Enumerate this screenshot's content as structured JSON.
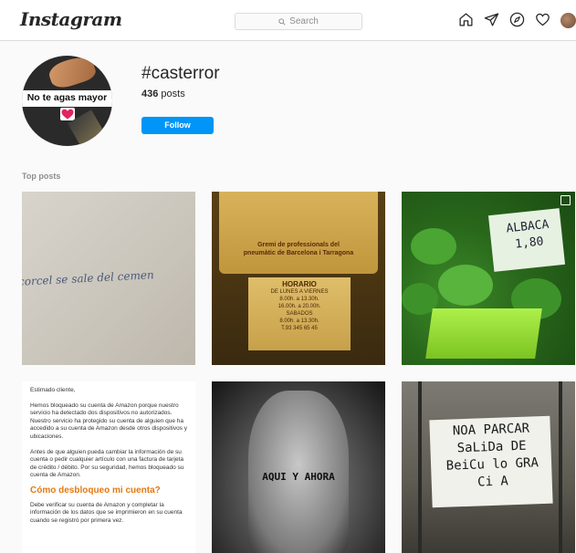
{
  "app": {
    "logo": "Instagram"
  },
  "header": {
    "search_placeholder": "Search"
  },
  "nav": {
    "icons": [
      "home-icon",
      "direct-icon",
      "explore-icon",
      "heart-icon",
      "profile-avatar"
    ]
  },
  "hashtag": {
    "title": "#casterror",
    "post_count": "436",
    "post_suffix": " posts",
    "follow_label": "Follow",
    "profile_pic_text": "No te agas mayor"
  },
  "section": {
    "top_posts": "Top posts"
  },
  "posts": [
    {
      "handwriting": "corcel se sale del cemen"
    },
    {
      "plate_line1": "Gremi de professionals del",
      "plate_line2": "pneumàtic de Barcelona i Tarragona",
      "board_title": "HORARIO",
      "board_lines": [
        "DE LUNES A VIERNES",
        "8.00h. a 13.30h.",
        "16.00h. a 20.00h.",
        "SABADOS",
        "8.00h. a 13.30h.",
        "T.93 345 65 45"
      ]
    },
    {
      "label_line1": "ALBACA",
      "label_line2": "1,80"
    },
    {
      "greeting": "Estimado cliente,",
      "para1": "Hemos bloqueado su cuenta de Amazon porque nuestro servicio ha detectado dos dispositivos no autorizados. Nuestro servicio ha protegido su cuenta de alguien que ha accedido a su cuenta de Amazon desde otros dispositivos y ubicaciones.",
      "para2": "Antes de que alguien pueda cambiar la información de su cuenta o pedir cualquier artículo con una factura de tarjeta de crédito / débito. Por su seguridad, hemos bloqueado su cuenta de Amazon.",
      "heading": "Cómo desbloqueo mi cuenta?",
      "para3": "Debe verificar su cuenta de Amazon y completar la información de los datos que se imprimieron en su cuenta cuando se registró por primera vez."
    },
    {
      "tattoo": "AQUI Y AHORA"
    },
    {
      "sign_line1": "NOA PARCAR",
      "sign_line2": "SaLiDa DE",
      "sign_line3": "BeiCu lo GRA",
      "sign_line4": "Ci A"
    }
  ],
  "colors": {
    "follow_bg": "#0095f6",
    "amazon_orange": "#e47911"
  }
}
